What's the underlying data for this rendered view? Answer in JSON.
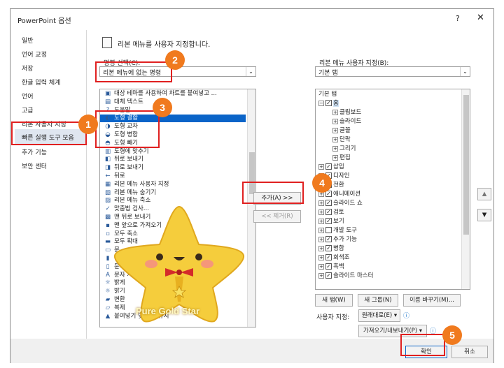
{
  "window": {
    "title": "PowerPoint 옵션",
    "help": "?",
    "close": "✕"
  },
  "nav": {
    "items": [
      "일반",
      "언어 교정",
      "저장",
      "한글 입력 체계",
      "언어",
      "고급",
      "리본 사용자 지정",
      "빠른 실행 도구 모음",
      "추가 기능",
      "보안 센터"
    ],
    "selected": "빠른 실행 도구 모음"
  },
  "header": {
    "title": "리본 메뉴를 사용자 지정합니다."
  },
  "left_panel": {
    "label": "명령 선택(C):",
    "combo_value": "리본 메뉴에 없는 명령",
    "commands": [
      "대상 테마를 사용하여 차트를 붙여넣고 ...",
      "대체 텍스트",
      "도움말",
      "도형 결합",
      "도형 교차",
      "도형 병합",
      "도형 빼기",
      "도형에 맞추기",
      "뒤로 보내기",
      "뒤로 보내기",
      "뒤로",
      "리본 메뉴 사용자 지정",
      "리본 메뉴 숨기기",
      "리본 메뉴 축소",
      "맞춤법 검사...",
      "맨 뒤로 보내기",
      "맨 앞으로 가져오기",
      "모두 축소",
      "모두 확대",
      "문",
      "문서",
      "문서 속성",
      "문자 서식",
      "밝게",
      "밝기",
      "변환",
      "복제",
      "붙여넣기 및 서식 유지"
    ],
    "selected": "도형 결합"
  },
  "middle": {
    "add": "추가(A) >>",
    "remove": "<< 제거(R)"
  },
  "right_panel": {
    "label": "리본 메뉴 사용자 지정(B):",
    "combo_value": "기본 탭",
    "tree": [
      {
        "t": "기본 탭",
        "lvl": 0,
        "pm": "",
        "cb": false
      },
      {
        "t": "홈",
        "lvl": 0,
        "pm": "−",
        "cb": true,
        "sel": true
      },
      {
        "t": "클립보드",
        "lvl": 1,
        "pm": "+",
        "cb": false
      },
      {
        "t": "슬라이드",
        "lvl": 1,
        "pm": "+",
        "cb": false
      },
      {
        "t": "글꼴",
        "lvl": 1,
        "pm": "+",
        "cb": false
      },
      {
        "t": "단락",
        "lvl": 1,
        "pm": "+",
        "cb": false
      },
      {
        "t": "그리기",
        "lvl": 1,
        "pm": "+",
        "cb": false
      },
      {
        "t": "편집",
        "lvl": 1,
        "pm": "+",
        "cb": false
      },
      {
        "t": "삽입",
        "lvl": 0,
        "pm": "+",
        "cb": true
      },
      {
        "t": "디자인",
        "lvl": 0,
        "pm": "+",
        "cb": true
      },
      {
        "t": "전환",
        "lvl": 0,
        "pm": "+",
        "cb": true
      },
      {
        "t": "애니메이션",
        "lvl": 0,
        "pm": "+",
        "cb": true
      },
      {
        "t": "슬라이드 쇼",
        "lvl": 0,
        "pm": "+",
        "cb": true
      },
      {
        "t": "검토",
        "lvl": 0,
        "pm": "+",
        "cb": true
      },
      {
        "t": "보기",
        "lvl": 0,
        "pm": "+",
        "cb": true
      },
      {
        "t": "개발 도구",
        "lvl": 0,
        "pm": "+",
        "cb": false,
        "empty": true
      },
      {
        "t": "추가 기능",
        "lvl": 0,
        "pm": "+",
        "cb": true
      },
      {
        "t": "병합",
        "lvl": 0,
        "pm": "+",
        "cb": true
      },
      {
        "t": "회색조",
        "lvl": 0,
        "pm": "+",
        "cb": true
      },
      {
        "t": "흑백",
        "lvl": 0,
        "pm": "+",
        "cb": true
      },
      {
        "t": "슬라이드 마스터",
        "lvl": 0,
        "pm": "+",
        "cb": true
      }
    ],
    "new_tab": "새 탭(W)",
    "new_group": "새 그룹(N)",
    "rename": "이름 바꾸기(M)...",
    "custom_label": "사용자 지정:",
    "reset_value": "원래대로(E) ▾",
    "import_export": "가져오기/내보내기(P) ▾"
  },
  "footer": {
    "ok": "확인",
    "cancel": "취소"
  },
  "badges": [
    "1",
    "2",
    "3",
    "4",
    "5"
  ],
  "sticker": {
    "caption": "Pure Gold Star"
  },
  "colors": {
    "accent": "#0a64c8",
    "badge": "#f07a1e",
    "highlight": "#e02020"
  }
}
